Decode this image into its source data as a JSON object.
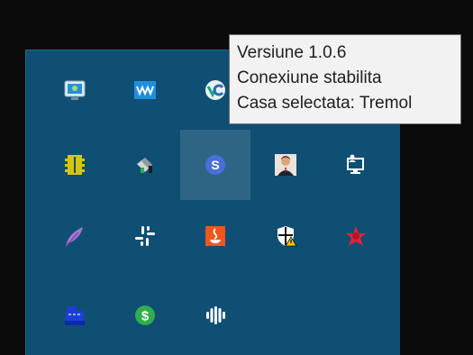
{
  "tooltip": {
    "version": "Versiune 1.0.6",
    "connection": "Conexiune stabilita",
    "selected_house": "Casa selectata: Tremol"
  },
  "tray": {
    "background_color": "#0f4f73",
    "hovered_icon": "sync-s-icon",
    "icons": [
      "network-monitor-icon",
      "audio-waves-icon",
      "vc-logo-icon",
      "device-chip-icon",
      "paint-bucket-icon",
      "sync-s-icon",
      "avatar-man-icon",
      "monitor-user-icon",
      "feather-icon",
      "slack-icon",
      "java-icon",
      "shield-warning-icon",
      "virus-star-icon",
      "cash-register-icon",
      "dollar-icon",
      "waveform-logo-icon"
    ]
  }
}
